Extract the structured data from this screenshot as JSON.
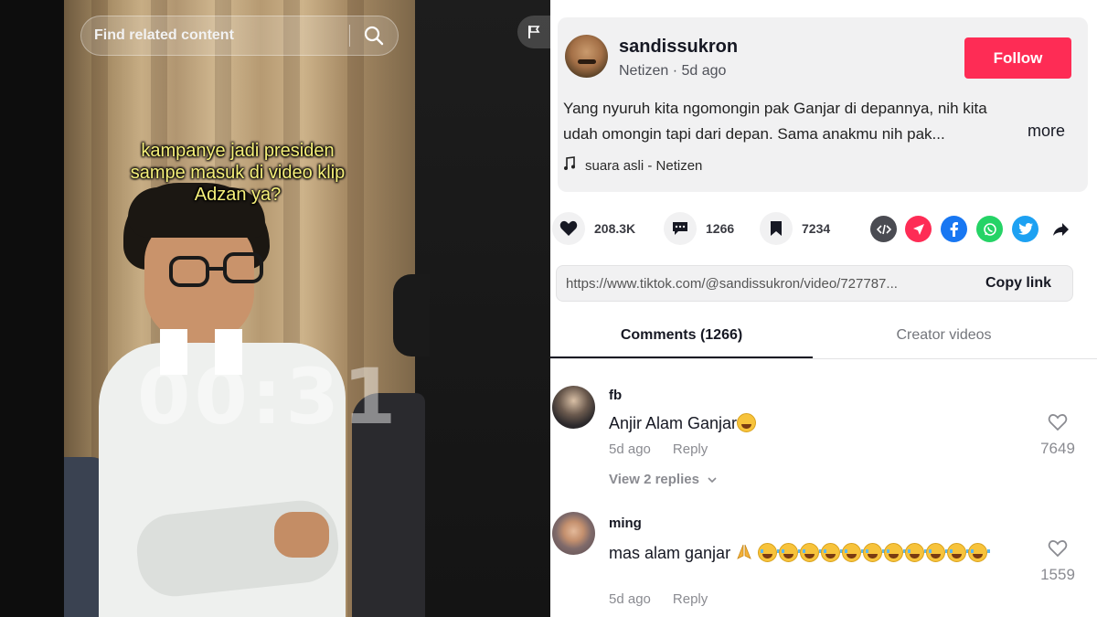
{
  "video": {
    "search_placeholder": "Find related content",
    "caption_lines": [
      "kampanye jadi presiden",
      "sampe masuk di video klip",
      "Adzan ya?"
    ],
    "timer": "00:31"
  },
  "post": {
    "author": "sandissukron",
    "author_sub": "Netizen · 5d ago",
    "follow_label": "Follow",
    "follow_color": "#fe2c55",
    "description_line1": "Yang nyuruh kita ngomongin pak Ganjar di depannya, nih kita",
    "description_line2": "udah omongin tapi dari depan. Sama anakmu nih pak...",
    "more_label": "more",
    "music": "suara asli - Netizen"
  },
  "actions": {
    "likes": "208.3K",
    "comments": "1266",
    "saves": "7234",
    "share_icons": [
      "embed-icon",
      "send-icon",
      "facebook-icon",
      "whatsapp-icon",
      "twitter-icon",
      "share-arrow-icon"
    ]
  },
  "link": {
    "url": "https://www.tiktok.com/@sandissukron/video/727787...",
    "copy_label": "Copy link"
  },
  "tabs": [
    "Comments (1266)",
    "Creator videos"
  ],
  "comments": [
    {
      "user": "fb",
      "text": "Anjir Alam Ganjar",
      "time": "5d ago",
      "reply_label": "Reply",
      "likes": "7649",
      "view_replies": "View 2 replies"
    },
    {
      "user": "ming",
      "text": "mas alam ganjar",
      "time": "5d ago",
      "reply_label": "Reply",
      "likes": "1559"
    }
  ]
}
